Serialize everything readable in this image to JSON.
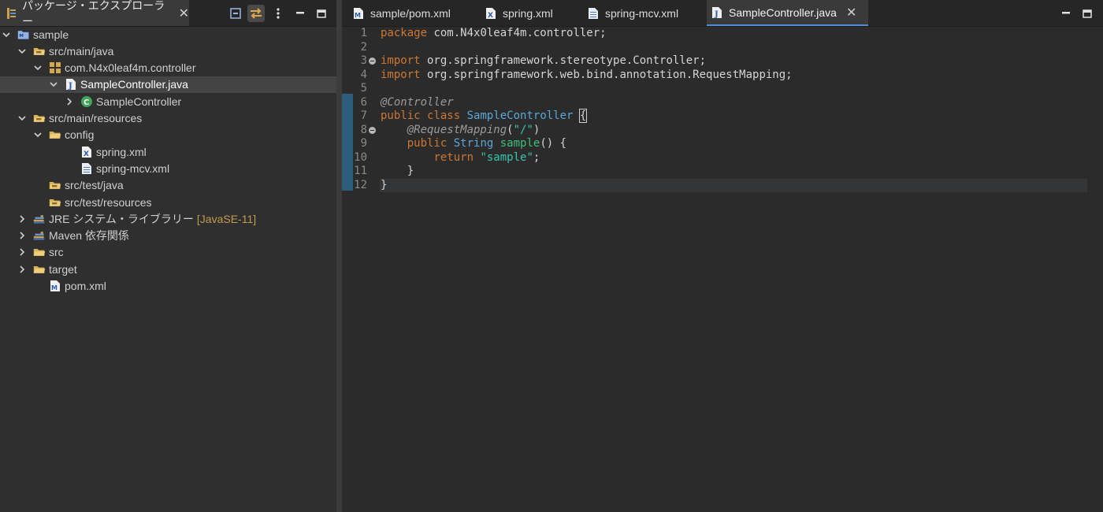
{
  "package_explorer": {
    "title": "パッケージ・エクスプローラー",
    "tree": [
      {
        "label": "sample",
        "decoration": "",
        "icon": "project-icon",
        "indent": 0,
        "expanded": true
      },
      {
        "label": "src/main/java",
        "decoration": "",
        "icon": "source-folder-icon",
        "indent": 1,
        "expanded": true
      },
      {
        "label": "com.N4x0leaf4m.controller",
        "decoration": "",
        "icon": "package-icon",
        "indent": 2,
        "expanded": true
      },
      {
        "label": "SampleController.java",
        "decoration": "",
        "icon": "java-file-icon",
        "indent": 3,
        "expanded": true,
        "selected": true
      },
      {
        "label": "SampleController",
        "decoration": "",
        "icon": "class-icon",
        "indent": 4,
        "expanded": false
      },
      {
        "label": "src/main/resources",
        "decoration": "",
        "icon": "source-folder-icon",
        "indent": 1,
        "expanded": true
      },
      {
        "label": "config",
        "decoration": "",
        "icon": "folder-icon",
        "indent": 2,
        "expanded": true
      },
      {
        "label": "spring.xml",
        "decoration": "",
        "icon": "xml-file-icon",
        "indent": 4,
        "expanded": null
      },
      {
        "label": "spring-mcv.xml",
        "decoration": "",
        "icon": "text-file-icon",
        "indent": 4,
        "expanded": null
      },
      {
        "label": "src/test/java",
        "decoration": "",
        "icon": "source-folder-icon",
        "indent": 2,
        "expanded": null
      },
      {
        "label": "src/test/resources",
        "decoration": "",
        "icon": "source-folder-icon",
        "indent": 2,
        "expanded": null
      },
      {
        "label": "JRE システム・ライブラリー",
        "decoration": "[JavaSE-11]",
        "icon": "library-icon",
        "indent": 1,
        "expanded": false
      },
      {
        "label": "Maven 依存関係",
        "decoration": "",
        "icon": "library-icon",
        "indent": 1,
        "expanded": false
      },
      {
        "label": "src",
        "decoration": "",
        "icon": "folder-icon",
        "indent": 1,
        "expanded": false
      },
      {
        "label": "target",
        "decoration": "",
        "icon": "folder-icon",
        "indent": 1,
        "expanded": false
      },
      {
        "label": "pom.xml",
        "decoration": "",
        "icon": "maven-file-icon",
        "indent": 2,
        "expanded": null
      }
    ]
  },
  "editor_tabs": [
    {
      "label": "sample/pom.xml",
      "icon": "maven-file-icon",
      "active": false
    },
    {
      "label": "spring.xml",
      "icon": "xml-file-icon",
      "active": false
    },
    {
      "label": "spring-mcv.xml",
      "icon": "text-file-icon",
      "active": false
    },
    {
      "label": "SampleController.java",
      "icon": "java-file-icon",
      "active": true
    }
  ],
  "code_lines": [
    {
      "n": "1",
      "tokens": [
        [
          "kw",
          "package"
        ],
        [
          "t",
          " com.N4x0leaf4m.controller;"
        ]
      ]
    },
    {
      "n": "2",
      "tokens": []
    },
    {
      "n": "3",
      "fold": true,
      "tokens": [
        [
          "kw",
          "import"
        ],
        [
          "t",
          " org.springframework.stereotype.Controller;"
        ]
      ]
    },
    {
      "n": "4",
      "tokens": [
        [
          "kw",
          "import"
        ],
        [
          "t",
          " org.springframework.web.bind.annotation.RequestMapping;"
        ]
      ]
    },
    {
      "n": "5",
      "tokens": []
    },
    {
      "n": "6",
      "tokens": [
        [
          "an",
          "@Controller"
        ]
      ]
    },
    {
      "n": "7",
      "tokens": [
        [
          "kw",
          "public"
        ],
        [
          "t",
          " "
        ],
        [
          "kw",
          "class"
        ],
        [
          "t",
          " "
        ],
        [
          "ty",
          "SampleController"
        ],
        [
          "t",
          " "
        ],
        [
          "br",
          "{"
        ]
      ]
    },
    {
      "n": "8",
      "fold": true,
      "tokens": [
        [
          "t",
          "    "
        ],
        [
          "an",
          "@RequestMapping"
        ],
        [
          "t",
          "("
        ],
        [
          "st",
          "\"/\""
        ],
        [
          "t",
          ")"
        ]
      ]
    },
    {
      "n": "9",
      "tokens": [
        [
          "t",
          "    "
        ],
        [
          "kw",
          "public"
        ],
        [
          "t",
          " "
        ],
        [
          "ty",
          "String"
        ],
        [
          "t",
          " "
        ],
        [
          "mt",
          "sample"
        ],
        [
          "t",
          "() {"
        ]
      ]
    },
    {
      "n": "10",
      "tokens": [
        [
          "t",
          "        "
        ],
        [
          "kw",
          "return"
        ],
        [
          "t",
          " "
        ],
        [
          "st",
          "\"sample\""
        ],
        [
          "t",
          ";"
        ]
      ]
    },
    {
      "n": "11",
      "tokens": [
        [
          "t",
          "    }"
        ]
      ]
    },
    {
      "n": "12",
      "current": true,
      "tokens": [
        [
          "t",
          "}"
        ]
      ]
    }
  ],
  "colors": {
    "keyword": "#cc7832",
    "type": "#5aa7d8",
    "method": "#3fbf7a",
    "annotation": "#9b9b9b",
    "string": "#36c4b0",
    "selection": "#444444",
    "active_tab_underline": "#4a8fd6"
  }
}
